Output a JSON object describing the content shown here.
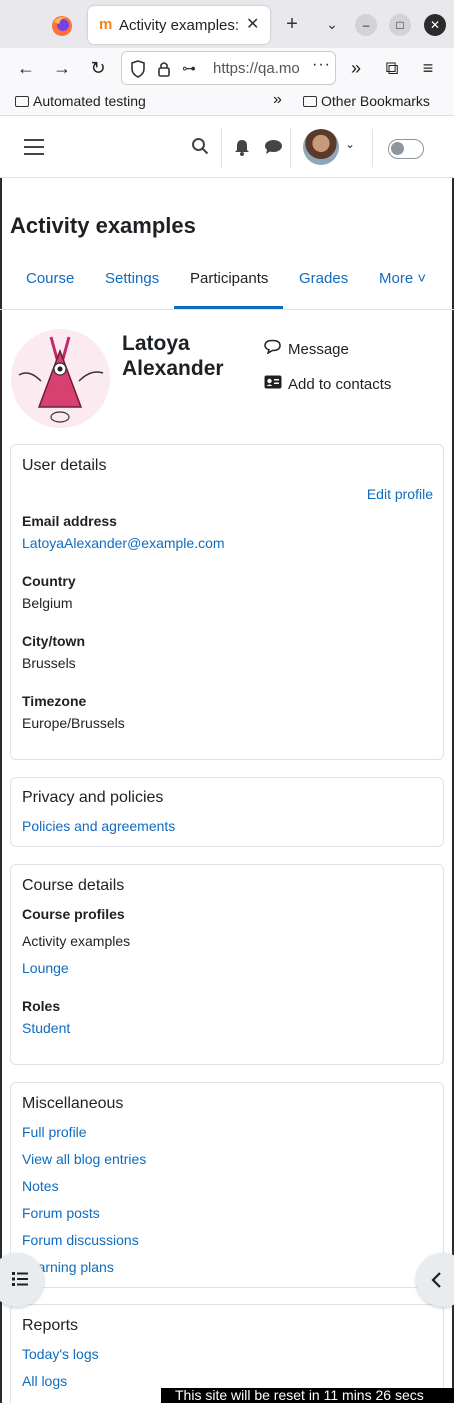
{
  "browser": {
    "tab_title": "Activity examples: I",
    "url": "https://qa.mo",
    "bookmarks": [
      "Automated testing",
      "Other Bookmarks"
    ]
  },
  "header": {
    "icons": [
      "menu-icon",
      "search-icon",
      "bell-icon",
      "chat-icon",
      "avatar",
      "toggle"
    ]
  },
  "page_title": "Activity examples",
  "secondary_nav": [
    {
      "label": "Course"
    },
    {
      "label": "Settings"
    },
    {
      "label": "Participants",
      "active": true
    },
    {
      "label": "Grades"
    },
    {
      "label": "More ˅"
    }
  ],
  "profile": {
    "first_name": "Latoya",
    "last_name": "Alexander",
    "message_label": "Message",
    "add_contact_label": "Add to contacts"
  },
  "user_details": {
    "title": "User details",
    "edit_profile": "Edit profile",
    "email_label": "Email address",
    "email": "LatoyaAlexander@example.com",
    "country_label": "Country",
    "country": "Belgium",
    "city_label": "City/town",
    "city": "Brussels",
    "timezone_label": "Timezone",
    "timezone": "Europe/Brussels"
  },
  "privacy": {
    "title": "Privacy and policies",
    "link": "Policies and agreements"
  },
  "course_details": {
    "title": "Course details",
    "profiles_label": "Course profiles",
    "profiles": [
      "Activity examples",
      "Lounge"
    ],
    "roles_label": "Roles",
    "role": "Student"
  },
  "misc": {
    "title": "Miscellaneous",
    "links": [
      "Full profile",
      "View all blog entries",
      "Notes",
      "Forum posts",
      "Forum discussions",
      "Learning plans"
    ]
  },
  "reports": {
    "title": "Reports",
    "links": [
      "Today's logs",
      "All logs"
    ]
  },
  "reset_banner": "This site will be reset in 11 mins 26 secs"
}
